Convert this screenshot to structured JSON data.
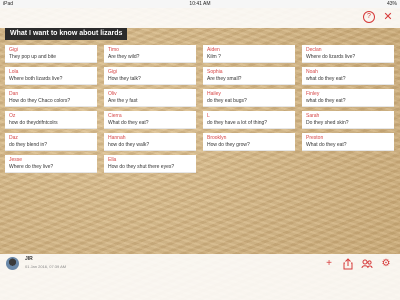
{
  "status_bar": {
    "device": "iPad",
    "time": "10:41 AM",
    "battery": "43%"
  },
  "board": {
    "title": "What I want to know about lizards"
  },
  "cards": [
    {
      "name": "Gigi",
      "text": "They pop up and bite"
    },
    {
      "name": "Timo",
      "text": "Are they wild?"
    },
    {
      "name": "Aiden",
      "text": "Kilm ?"
    },
    {
      "name": "Declan",
      "text": "Where do lizards live?"
    },
    {
      "name": "Lola",
      "text": "Where both lizards live?"
    },
    {
      "name": "Gigi",
      "text": "How they  talk?"
    },
    {
      "name": "Sophia",
      "text": "Are they small?"
    },
    {
      "name": "Noah",
      "text": "what do they eat?"
    },
    {
      "name": "Dan",
      "text": "How do they Chaco colors?"
    },
    {
      "name": "Oliv",
      "text": "Are the y fast"
    },
    {
      "name": "Hailey",
      "text": "do they eat bugs?"
    },
    {
      "name": "Finley",
      "text": "what do they eat?"
    },
    {
      "name": "Oz",
      "text": "how do theydrifntcolrs"
    },
    {
      "name": "Cierra",
      "text": "What do they eat?"
    },
    {
      "name": "L",
      "text": "do they have a lot of thing?"
    },
    {
      "name": "Sarah",
      "text": "Do they shed skin?"
    },
    {
      "name": "Daz",
      "text": "do they blend in?"
    },
    {
      "name": "Hannah",
      "text": "how do they walk?"
    },
    {
      "name": "Brooklyn",
      "text": "How do they  grow?"
    },
    {
      "name": "Preston",
      "text": "What do they eat?"
    },
    {
      "name": "Jesse",
      "text": "Where do they live?"
    },
    {
      "name": "Ella",
      "text": "How do they shut there eyes?"
    }
  ],
  "footer": {
    "author": "JIR",
    "date": "01 Jan 2016, 07:39 AM"
  },
  "icons": {
    "help": "question-icon",
    "close": "close-icon",
    "add": "plus-icon",
    "share": "share-icon",
    "settings": "gear-icon",
    "follow": "people-icon"
  },
  "accent_color": "#d63a3a"
}
